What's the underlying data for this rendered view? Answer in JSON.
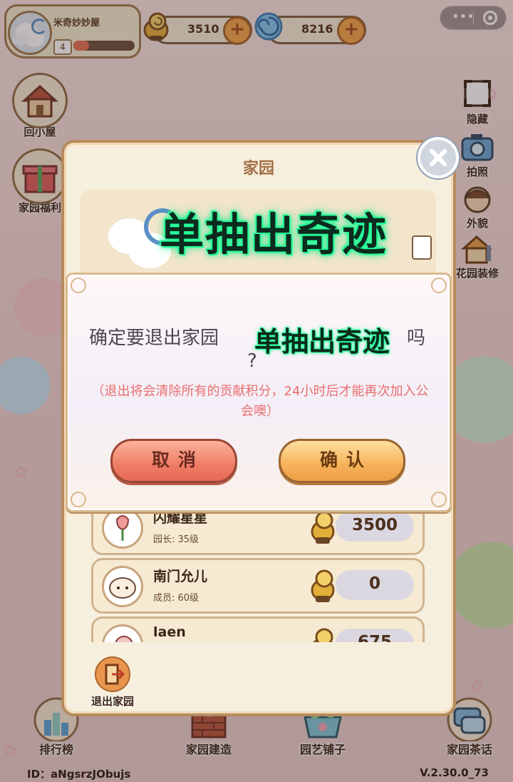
{
  "profile": {
    "name": "米奇妙妙屋",
    "level": "4",
    "exp_fraction": 0.25
  },
  "currency": {
    "coins": "3510",
    "gems": "8216"
  },
  "left_menu": {
    "home_label": "回小屋",
    "welfare_label": "家园福利"
  },
  "right_menu": {
    "hide_label": "隐藏",
    "photo_label": "拍照",
    "appearance_label": "外貌",
    "decorate_label": "花园装修"
  },
  "garden_panel": {
    "title": "家园",
    "members": [
      {
        "name": "闪耀星星",
        "role": "园长: 35级",
        "score": "3500"
      },
      {
        "name": "南门允儿",
        "role": "成员: 60级",
        "score": "0"
      },
      {
        "name": "laen",
        "role": "",
        "score": "675"
      }
    ],
    "exit_label": "退出家园"
  },
  "overlay": {
    "miracle_big": "单抽出奇迹",
    "miracle_small": "单抽出奇迹"
  },
  "dialog": {
    "question_prefix": "确定要退出家园",
    "question_suffix": "吗",
    "question_mark": "?",
    "warning": "（退出将会清除所有的贡献积分，24小时后才能再次加入公会噢）",
    "cancel_label": "取消",
    "confirm_label": "确认"
  },
  "bottom_nav": [
    {
      "label": "排行榜"
    },
    {
      "label": "家园建造"
    },
    {
      "label": "园艺铺子"
    },
    {
      "label": "家园茶话"
    }
  ],
  "footer": {
    "id": "ID：aNgsrzJObujs",
    "version": "V.2.30.0_73"
  },
  "colors": {
    "accent_green": "#27ff9b",
    "warning_red": "#ea6f6f",
    "cancel": "#ef7d66",
    "confirm": "#f6b25a"
  }
}
